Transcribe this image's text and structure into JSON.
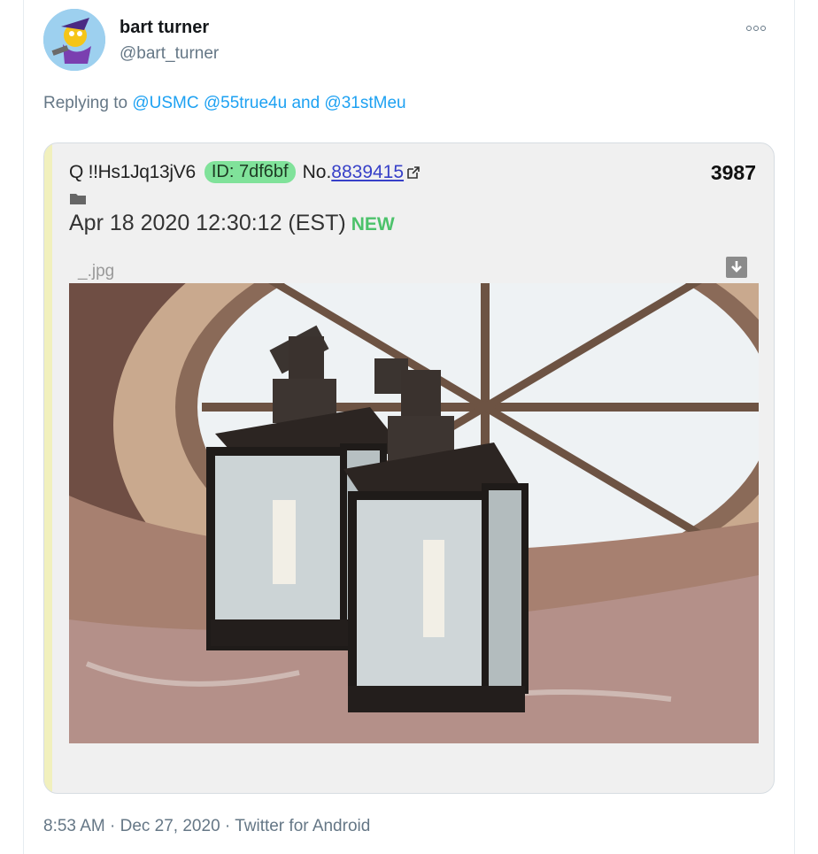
{
  "tweet": {
    "display_name": "bart turner",
    "handle": "@bart_turner",
    "reply_prefix": "Replying to",
    "reply_mentions": [
      "@USMC",
      "@55true4u",
      "@31stMeu"
    ],
    "reply_conjunction": "and",
    "time": "8:53 AM",
    "date": "Dec 27, 2020",
    "source": "Twitter for Android",
    "separator": "·"
  },
  "embedded_post": {
    "poster": "Q !!Hs1Jq13jV6",
    "id_label": "ID: 7df6bf",
    "no_prefix": "No.",
    "post_number": "8839415",
    "count": "3987",
    "datetime": "Apr 18 2020 12:30:12 (EST)",
    "new_badge": "NEW",
    "file_name": "_.jpg"
  },
  "icons": {
    "more": "more-options-icon",
    "external_link": "external-link-icon",
    "folder": "folder-icon",
    "download": "download-icon"
  },
  "colors": {
    "link": "#1da1f2",
    "id_pill": "#80e29a",
    "new_badge": "#4cc26b",
    "post_link": "#3740c8"
  }
}
